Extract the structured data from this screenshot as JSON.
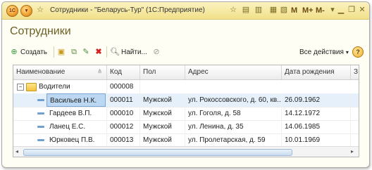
{
  "window": {
    "title": "Сотрудники - \"Беларусь-Тур\"  (1С:Предприятие)",
    "logo_text": "1С",
    "titlebar_buttons": {
      "m": "M",
      "mplus": "M+",
      "mminus": "M-"
    }
  },
  "page": {
    "title": "Сотрудники"
  },
  "toolbar": {
    "create_label": "Создать",
    "find_label": "Найти...",
    "all_actions_label": "Все действия",
    "help_label": "?"
  },
  "table": {
    "columns": [
      "Наименование",
      "Код",
      "Пол",
      "Адрес",
      "Дата рождения",
      "З"
    ],
    "group_row": {
      "name": "Водители",
      "code": "000008"
    },
    "rows": [
      {
        "name": "Васильев Н.К.",
        "code": "000011",
        "gender": "Мужской",
        "address": "ул. Рокоссовского, д. 60, кв....",
        "birth_date": "26.09.1962",
        "selected": true
      },
      {
        "name": "Гардеев В.П.",
        "code": "000010",
        "gender": "Мужской",
        "address": "ул. Гоголя, д. 58",
        "birth_date": "14.12.1972",
        "selected": false
      },
      {
        "name": "Ланец Е.С.",
        "code": "000012",
        "gender": "Мужской",
        "address": "ул. Ленина, д. 35",
        "birth_date": "14.06.1985",
        "selected": false
      },
      {
        "name": "Юрковец П.В.",
        "code": "000013",
        "gender": "Мужской",
        "address": "ул. Пролетарская, д. 59",
        "birth_date": "10.01.1969",
        "selected": false
      }
    ]
  },
  "colors": {
    "titlebar": "#f1e08a",
    "page_title": "#6a5f24",
    "selection": "#bcd7f2"
  }
}
